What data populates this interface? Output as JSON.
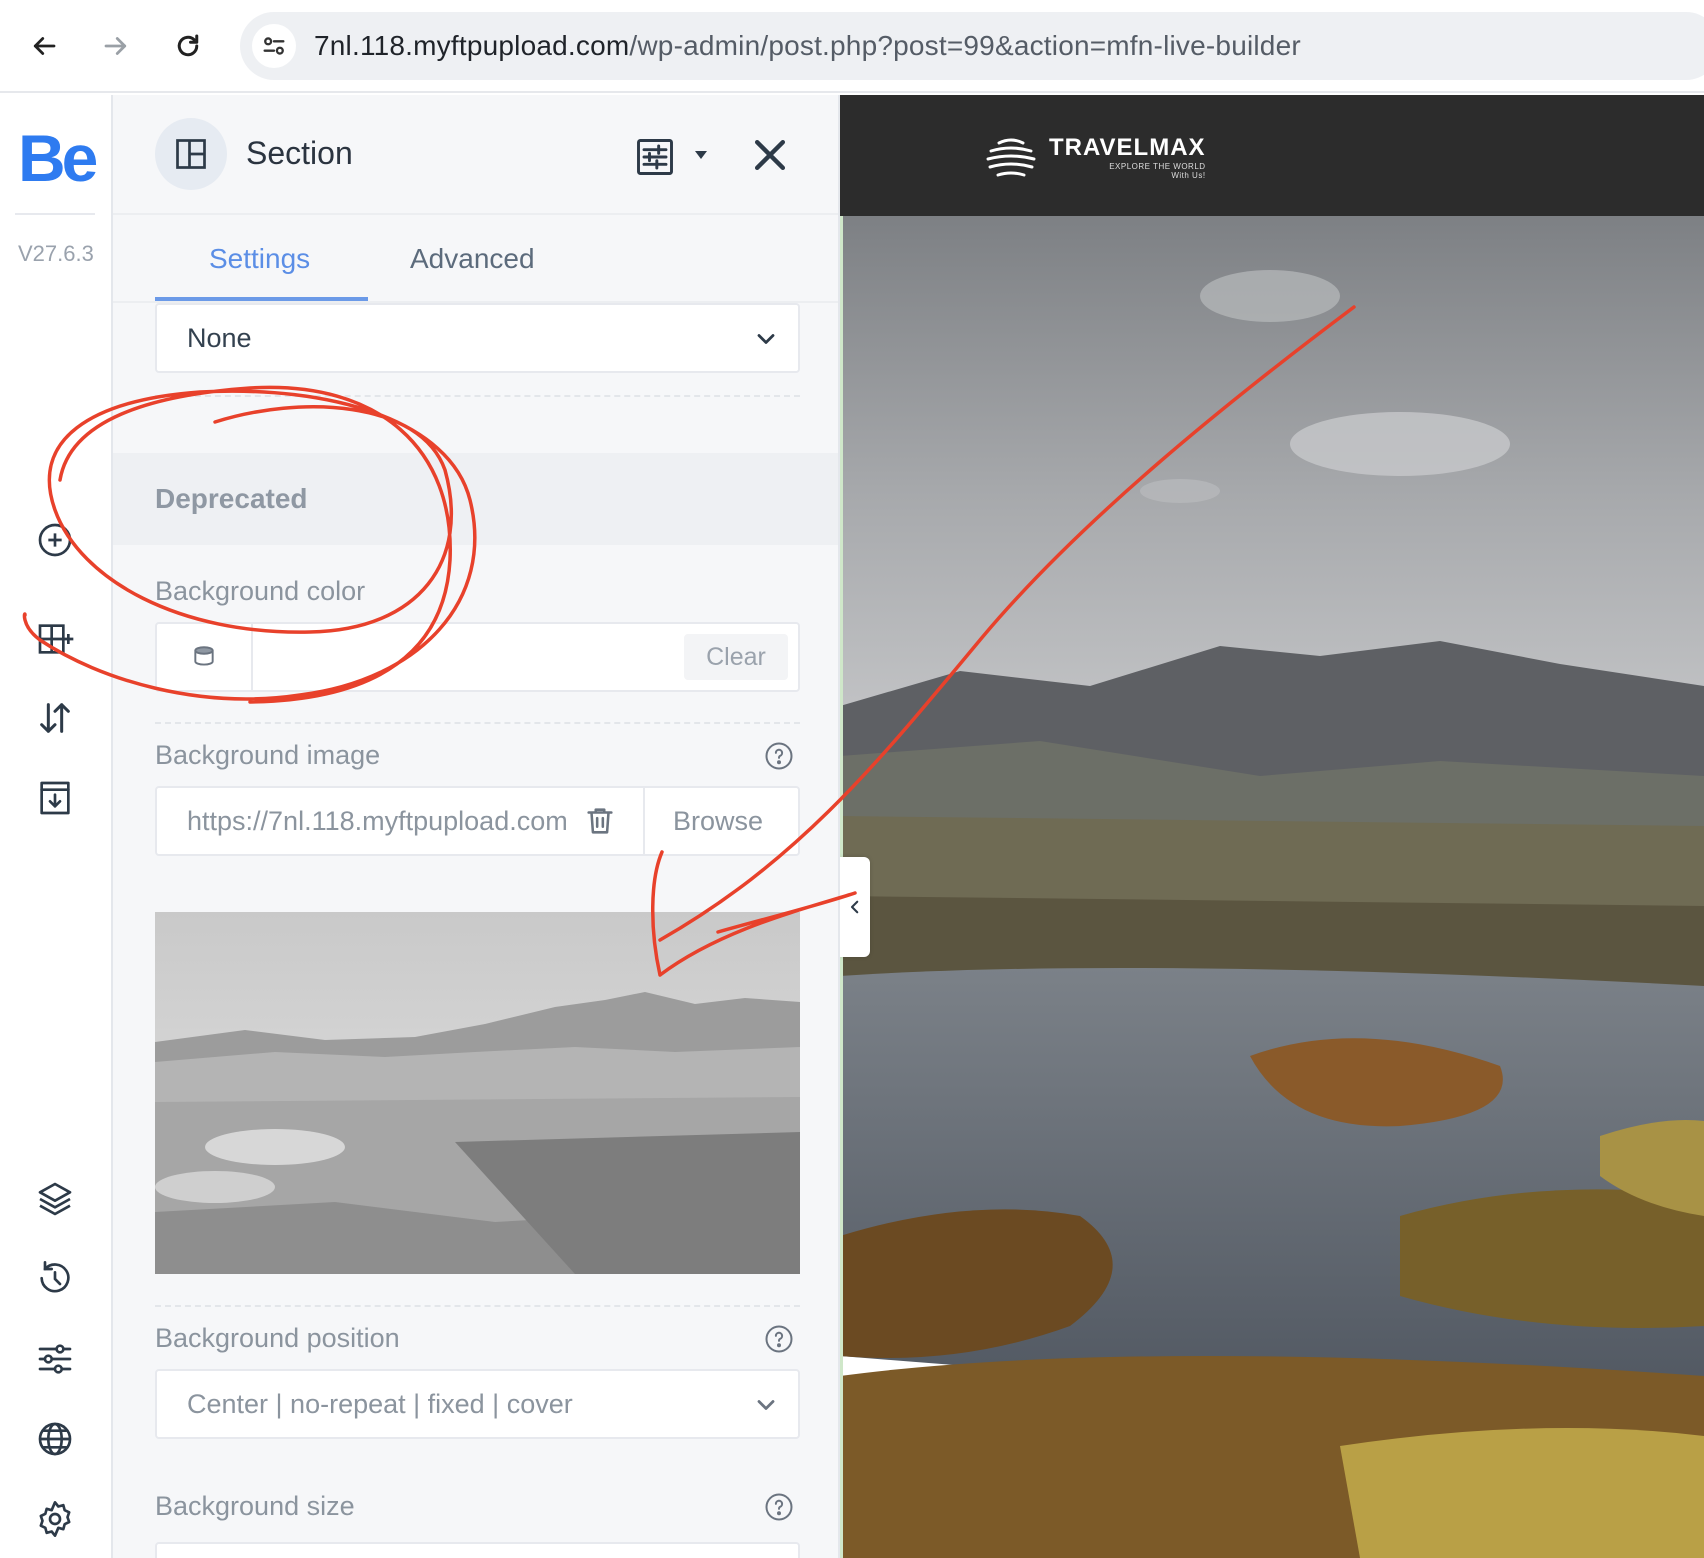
{
  "browser": {
    "url_host": "7nl.118.myftpupload.com",
    "url_path": "/wp-admin/post.php?post=99&action=mfn-live-builder"
  },
  "rail": {
    "logo": "Be",
    "version": "V27.6.3",
    "icons": [
      "add-circle-icon",
      "add-section-icon",
      "sort-arrows-icon",
      "templates-icon",
      "layers-icon",
      "history-icon",
      "options-sliders-icon",
      "globe-icon",
      "gear-icon"
    ]
  },
  "panel": {
    "title": "Section",
    "tabs": {
      "settings": "Settings",
      "advanced": "Advanced"
    },
    "top_select_value": "None",
    "deprecated_heading": "Deprecated",
    "bg_color": {
      "label": "Background color",
      "clear": "Clear"
    },
    "bg_image": {
      "label": "Background image",
      "value": "https://7nl.118.myftpupload.com",
      "browse": "Browse"
    },
    "bg_position": {
      "label": "Background position",
      "value": "Center | no-repeat | fixed | cover"
    },
    "bg_size": {
      "label": "Background size"
    }
  },
  "preview": {
    "brand_name": "TRAVELMAX",
    "brand_tag_1": "EXPLORE THE WORLD",
    "brand_tag_2": "With Us!"
  },
  "colors": {
    "accent": "#2e7bf0",
    "tab_active": "#5b8ee6",
    "annotation": "#e8412b",
    "topbar": "#2c2c2c"
  }
}
